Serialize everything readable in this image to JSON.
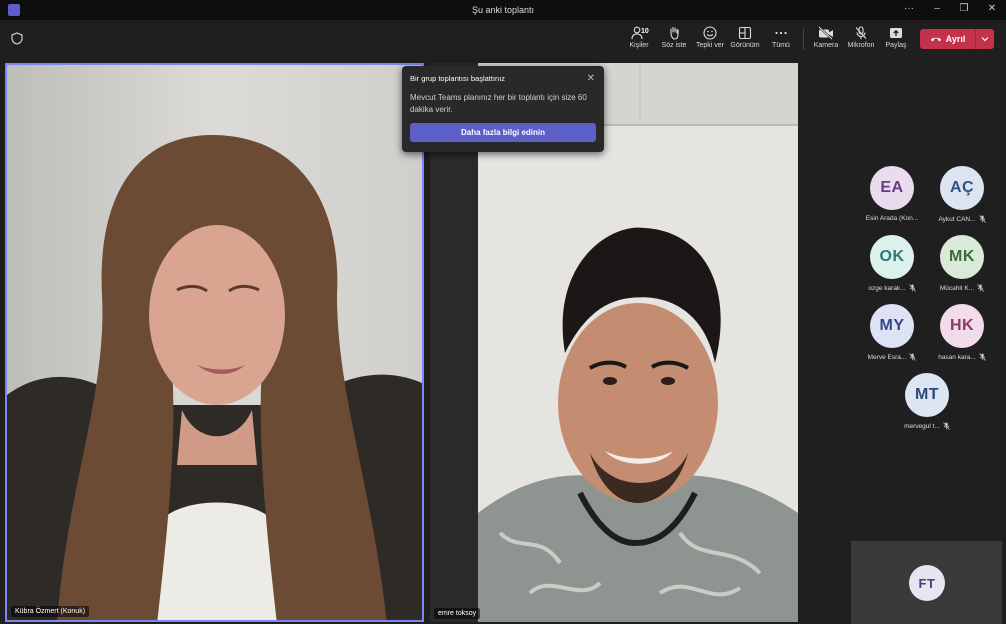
{
  "window": {
    "title": "Şu anki toplantı",
    "controls": [
      "···",
      "–",
      "❐",
      "✕"
    ]
  },
  "toolbar": {
    "people": {
      "label": "Kişiler",
      "count": "10",
      "icon": "people-icon"
    },
    "raise_hand": {
      "label": "Söz iste",
      "icon": "hand-icon"
    },
    "react": {
      "label": "Tepki ver",
      "icon": "smile-icon"
    },
    "view": {
      "label": "Görünüm",
      "icon": "grid-icon"
    },
    "more": {
      "label": "Tümü",
      "icon": "ellipsis-icon"
    },
    "camera": {
      "label": "Kamera",
      "icon": "camera-off-icon"
    },
    "mic": {
      "label": "Mikrofon",
      "icon": "mic-off-icon"
    },
    "share": {
      "label": "Paylaş",
      "icon": "share-icon"
    },
    "leave": {
      "label": "Ayrıl",
      "color": "#c4314b"
    }
  },
  "popover": {
    "title": "Bir grup toplantısı başlattınız",
    "body": "Mevcut Teams planınız her bir toplantı için size 60 dakika verir.",
    "button": "Daha fazla bilgi edinin"
  },
  "videos": [
    {
      "name": "Kübra Özmert (Konuk)"
    },
    {
      "name": "emre toksoy"
    }
  ],
  "participants": [
    {
      "initials": "EA",
      "name": "Esin Arada (Kon...",
      "muted": false,
      "bg": "#e8dcee",
      "fg": "#6b3a84"
    },
    {
      "initials": "AÇ",
      "name": "Aykut CAN...",
      "muted": true,
      "bg": "#dce4f2",
      "fg": "#2f4f8a"
    },
    {
      "initials": "OK",
      "name": "ozge karak...",
      "muted": true,
      "bg": "#dcf0ec",
      "fg": "#2f7a70"
    },
    {
      "initials": "MK",
      "name": "Mücahit K...",
      "muted": true,
      "bg": "#d9ead9",
      "fg": "#3b6b3b"
    },
    {
      "initials": "MY",
      "name": "Merve Esra...",
      "muted": true,
      "bg": "#dde2f4",
      "fg": "#36468c"
    },
    {
      "initials": "HK",
      "name": "hasan kara...",
      "muted": true,
      "bg": "#f3dcea",
      "fg": "#8a3a6a"
    },
    {
      "initials": "MT",
      "name": "mervegul t...",
      "muted": true,
      "bg": "#dde5f2",
      "fg": "#2f4a7a"
    }
  ],
  "self": {
    "initials": "FT",
    "bg": "#e8e4f2",
    "fg": "#4a3f7a"
  }
}
